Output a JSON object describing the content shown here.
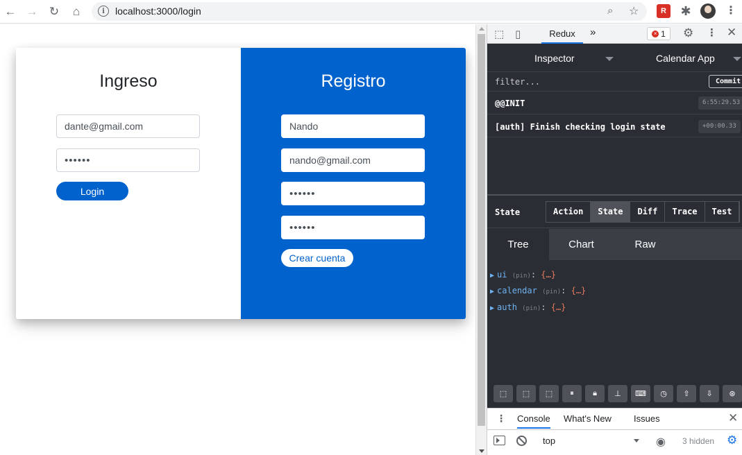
{
  "browser": {
    "url": "localhost:3000/login",
    "nav": {
      "back": "←",
      "forward": "→",
      "reload": "↻",
      "home": "⌂"
    },
    "icons": [
      "info-icon",
      "zoom-icon",
      "star-icon",
      "extension-icon",
      "puzzle-icon",
      "profile-avatar",
      "menu-icon"
    ]
  },
  "login": {
    "title": "Ingreso",
    "email_value": "dante@gmail.com",
    "password_value": "••••••",
    "button_label": "Login"
  },
  "register": {
    "title": "Registro",
    "name_value": "Nando",
    "email_value": "nando@gmail.com",
    "password_value": "••••••",
    "password_confirm_value": "••••••",
    "button_label": "Crear cuenta"
  },
  "devtools": {
    "active_tab": "Redux",
    "error_count": "1",
    "redux": {
      "monitor": "Inspector",
      "instance": "Calendar App",
      "filter_placeholder": "filter...",
      "commit_label": "Commit",
      "actions": [
        {
          "name": "@@INIT",
          "time": "6:55:29.53"
        },
        {
          "name": "[auth] Finish checking login state",
          "time": "+00:00.33"
        }
      ],
      "state_label": "State",
      "detail_tabs": [
        "Action",
        "State",
        "Diff",
        "Trace",
        "Test"
      ],
      "active_detail_tab": "State",
      "view_tabs": [
        "Tree",
        "Chart",
        "Raw"
      ],
      "active_view_tab": "Tree",
      "tree": [
        {
          "key": "ui",
          "pin": "(pin)",
          "value": "{…}"
        },
        {
          "key": "calendar",
          "pin": "(pin)",
          "value": "{…}"
        },
        {
          "key": "auth",
          "pin": "(pin)",
          "value": "{…}"
        }
      ]
    },
    "drawer": {
      "tabs": [
        "Console",
        "What's New",
        "Issues"
      ],
      "active_tab": "Console",
      "context": "top",
      "hidden_count": "3 hidden"
    }
  },
  "colors": {
    "primary": "#0062cc",
    "devtools_bg": "#2a2e34",
    "tree_key": "#6fb3f2",
    "tree_value": "#e97b5f"
  }
}
